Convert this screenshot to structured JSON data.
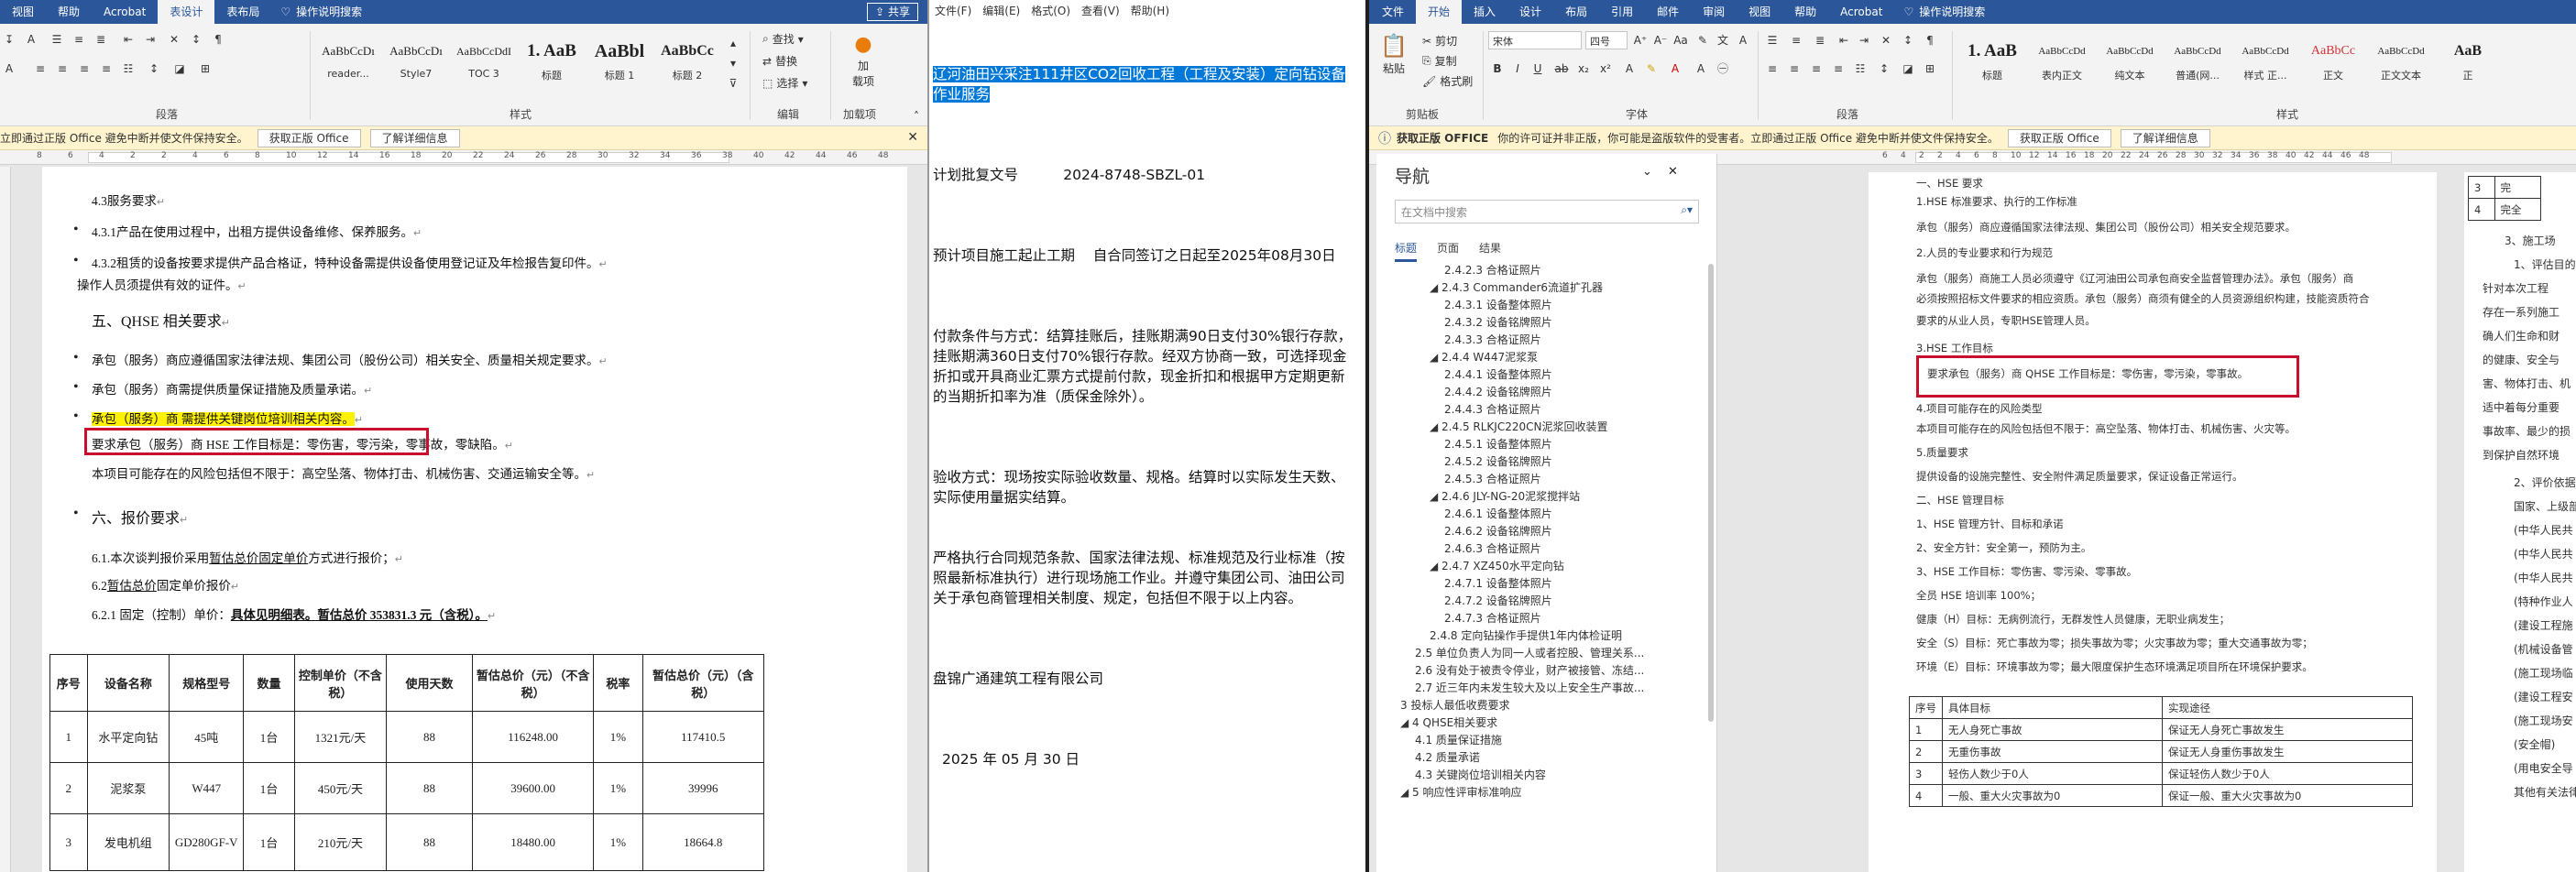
{
  "left_word": {
    "menu": [
      "视图",
      "帮助",
      "Acrobat",
      "表设计",
      "表布局"
    ],
    "menu_active": "表设计",
    "tell_me": "操作说明搜索",
    "share": "共享",
    "styles": [
      {
        "sample": "AaBbCcDı",
        "name": "reader..."
      },
      {
        "sample": "AaBbCcDı",
        "name": "Style7"
      },
      {
        "sample": "AaBbCcDdI",
        "name": "TOC 3"
      },
      {
        "sample": "1. AaB",
        "name": "标题"
      },
      {
        "sample": "AaBbl",
        "name": "标题 1"
      },
      {
        "sample": "AaBbCc",
        "name": "标题 2"
      }
    ],
    "editing": {
      "find": "查找",
      "replace": "替换",
      "select": "选择",
      "label": "编辑"
    },
    "addin": {
      "label": "加载项",
      "sub": "加\n载项"
    },
    "group_labels": {
      "paragraph": "段落",
      "styles": "样式",
      "editing": "编辑",
      "addins": "加载项"
    },
    "msgbar": {
      "text": "立即通过正版 Office 避免中断并使文件保持安全。",
      "btn1": "获取正版 Office",
      "btn2": "了解详细信息"
    },
    "ruler": [
      "8",
      "6",
      "4",
      "2",
      "2",
      "4",
      "6",
      "8",
      "10",
      "12",
      "14",
      "16",
      "18",
      "20",
      "22",
      "24",
      "26",
      "28",
      "30",
      "32",
      "34",
      "36",
      "38",
      "40",
      "42",
      "44",
      "46",
      "48"
    ],
    "doc": {
      "l1": "4.3服务要求",
      "l2": "4.3.1产品在使用过程中，出租方提供设备维修、保养服务。",
      "l3": "4.3.2租赁的设备按要求提供产品合格证，特种设备需提供设备使用登记证及年检报告复印件。",
      "l4": "操作人员须提供有效的证件。",
      "h5": "五、QHSE 相关要求",
      "l6": "承包（服务）商应遵循国家法律法规、集团公司（股份公司）相关安全、质量相关规定要求。",
      "l7": "承包（服务）商需提供质量保证措施及质量承诺。",
      "l8": "承包（服务）商 需提供关键岗位培训相关内容。",
      "l9": "要求承包（服务）商 HSE 工作目标是：零伤害，零污染，零事故，零缺陷。",
      "l10": "本项目可能存在的风险包括但不限于：高空坠落、物体打击、机械伤害、交通运输安全等。",
      "h11": "六、报价要求",
      "l12a": "6.1.本次谈判报价采用",
      "l12b": "暂估总价固定单价",
      "l12c": "方式进行报价；",
      "l13a": "6.2",
      "l13b": "暂估总价",
      "l13c": "固定单价报价",
      "l14a": "6.2.1 固定（控制）单价：",
      "l14b": "具体见明细表。暂估总价 353831.3 元（含税）。"
    },
    "table": {
      "headers": [
        "序号",
        "设备名称",
        "规格型号",
        "数量",
        "控制单价（不含税）",
        "使用天数",
        "暂估总价（元）（不含税）",
        "税率",
        "暂估总价（元）（含税）"
      ],
      "rows": [
        [
          "1",
          "水平定向钻",
          "45吨",
          "1台",
          "1321元/天",
          "88",
          "116248.00",
          "1%",
          "117410.5"
        ],
        [
          "2",
          "泥浆泵",
          "W447",
          "1台",
          "450元/天",
          "88",
          "39600.00",
          "1%",
          "39996"
        ],
        [
          "3",
          "发电机组",
          "GD280GF-V",
          "1台",
          "210元/天",
          "88",
          "18480.00",
          "1%",
          "18664.8"
        ]
      ]
    }
  },
  "notepad": {
    "menu": [
      "文件(F)",
      "编辑(E)",
      "格式(O)",
      "查看(V)",
      "帮助(H)"
    ],
    "selected": "辽河油田兴采注111井区CO2回收工程（工程及安装）定向钻设备作业服务",
    "lines": [
      "计划批复文号          2024-8748-SBZL-01",
      "预计项目施工起止工期    自合同签订之日起至2025年08月30日",
      "付款条件与方式：结算挂账后，挂账期满90日支付30%银行存款，挂账期满360日支付70%银行存款。经双方协商一致，可选择现金折扣或开具商业汇票方式提前付款，现金折扣和根据甲方定期更新的当期折扣率为准（质保金除外）。",
      "验收方式：现场按实际验收数量、规格。结算时以实际发生天数、实际使用量据实结算。",
      "严格执行合同规范条款、国家法律法规、标准规范及行业标准（按照最新标准执行）进行现场施工作业。并遵守集团公司、油田公司关于承包商管理相关制度、规定，包括但不限于以上内容。",
      "盘锦广通建筑工程有限公司",
      "2025 年 05 月 30 日"
    ]
  },
  "right_word": {
    "menu": [
      "文件",
      "开始",
      "插入",
      "设计",
      "布局",
      "引用",
      "邮件",
      "审阅",
      "视图",
      "帮助",
      "Acrobat",
      "操作说明搜索"
    ],
    "menu_active": "开始",
    "clipboard": {
      "paste": "粘贴",
      "cut": "剪切",
      "copy": "复制",
      "painter": "格式刷",
      "label": "剪贴板"
    },
    "font": {
      "name": "宋体",
      "size": "四号",
      "label": "字体"
    },
    "paragraph_label": "段落",
    "styles_label": "样式",
    "styles": [
      {
        "sample": "1. AaB",
        "name": "标题"
      },
      {
        "sample": "AaBbCcDd",
        "name": "表内正文"
      },
      {
        "sample": "AaBbCcDd",
        "name": "纯文本"
      },
      {
        "sample": "AaBbCcDd",
        "name": "普通(网..."
      },
      {
        "sample": "AaBbCcDd",
        "name": "样式 正..."
      },
      {
        "sample": "AaBbCc",
        "name": "正文"
      },
      {
        "sample": "AaBbCcDd",
        "name": "正文文本"
      },
      {
        "sample": "AaB",
        "name": "正"
      }
    ],
    "msgbar": {
      "title": "获取正版 OFFICE",
      "text": "你的许可证并非正版，你可能是盗版软件的受害者。立即通过正版 Office 避免中断并使文件保持安全。",
      "btn1": "获取正版 Office",
      "btn2": "了解详细信息"
    },
    "nav": {
      "title": "导航",
      "search_placeholder": "在文档中搜索",
      "tabs": [
        "标题",
        "页面",
        "结果"
      ],
      "items": [
        {
          "level": 4,
          "text": "2.4.2.3 合格证照片"
        },
        {
          "level": 3,
          "text": "◢ 2.4.3 Commander6流道扩孔器"
        },
        {
          "level": 4,
          "text": "2.4.3.1 设备整体照片"
        },
        {
          "level": 4,
          "text": "2.4.3.2 设备铭牌照片"
        },
        {
          "level": 4,
          "text": "2.4.3.3 合格证照片"
        },
        {
          "level": 3,
          "text": "◢ 2.4.4 W447泥浆泵"
        },
        {
          "level": 4,
          "text": "2.4.4.1 设备整体照片"
        },
        {
          "level": 4,
          "text": "2.4.4.2 设备铭牌照片"
        },
        {
          "level": 4,
          "text": "2.4.4.3 合格证照片"
        },
        {
          "level": 3,
          "text": "◢ 2.4.5 RLKJC220CN泥浆回收装置"
        },
        {
          "level": 4,
          "text": "2.4.5.1 设备整体照片"
        },
        {
          "level": 4,
          "text": "2.4.5.2 设备铭牌照片"
        },
        {
          "level": 4,
          "text": "2.4.5.3 合格证照片"
        },
        {
          "level": 3,
          "text": "◢ 2.4.6 JLY-NG-20泥浆搅拌站"
        },
        {
          "level": 4,
          "text": "2.4.6.1 设备整体照片"
        },
        {
          "level": 4,
          "text": "2.4.6.2 设备铭牌照片"
        },
        {
          "level": 4,
          "text": "2.4.6.3 合格证照片"
        },
        {
          "level": 3,
          "text": "◢ 2.4.7 XZ450水平定向钻"
        },
        {
          "level": 4,
          "text": "2.4.7.1 设备整体照片"
        },
        {
          "level": 4,
          "text": "2.4.7.2 设备铭牌照片"
        },
        {
          "level": 4,
          "text": "2.4.7.3 合格证照片"
        },
        {
          "level": 3,
          "text": "2.4.8 定向钻操作手提供1年内体检证明"
        },
        {
          "level": 2,
          "text": "2.5 单位负责人为同一人或者控股、管理关系..."
        },
        {
          "level": 2,
          "text": "2.6 没有处于被责令停业，财产被接管、冻结..."
        },
        {
          "level": 2,
          "text": "2.7 近三年内未发生较大及以上安全生产事故..."
        },
        {
          "level": 1,
          "text": "3 投标人最低收费要求"
        },
        {
          "level": 1,
          "text": "◢ 4 QHSE相关要求"
        },
        {
          "level": 2,
          "text": "4.1 质量保证措施"
        },
        {
          "level": 2,
          "text": "4.2 质量承诺"
        },
        {
          "level": 2,
          "text": "4.3 关键岗位培训相关内容"
        },
        {
          "level": 1,
          "text": "◢ 5 响应性评审标准响应"
        }
      ]
    },
    "ruler": [
      "6",
      "4",
      "2",
      "2",
      "4",
      "6",
      "8",
      "10",
      "12",
      "14",
      "16",
      "18",
      "20",
      "22",
      "24",
      "26",
      "28",
      "30",
      "32",
      "34",
      "36",
      "38",
      "40",
      "42",
      "44",
      "46",
      "48"
    ],
    "doc": {
      "l0": "一、HSE 要求",
      "l1": "1.HSE 标准要求、执行的工作标准",
      "l2": "承包（服务）商应遵循国家法律法规、集团公司（股份公司）相关安全规范要求。",
      "l3": "2.人员的专业要求和行为规范",
      "l4": "承包（服务）商施工人员必须遵守《辽河油田公司承包商安全监督管理办法》。承包（服务）商",
      "l5": "必须按照招标文件要求的相应资质。承包（服务）商须有健全的人员资源组织构建，技能资质符合",
      "l6": "要求的从业人员，专职HSE管理人员。",
      "l7": "3.HSE 工作目标",
      "l8": "要求承包（服务）商 QHSE 工作目标是：零伤害，零污染，零事故。",
      "l9": "4.项目可能存在的风险类型",
      "l10": "本项目可能存在的风险包括但不限于：高空坠落、物体打击、机械伤害、火灾等。",
      "l11": "5.质量要求",
      "l12": "提供设备的设施完整性、安全附件满足质量要求，保证设备正常运行。",
      "l13": "二、HSE 管理目标",
      "l14": "1、HSE 管理方针、目标和承诺",
      "l15": "2、安全方针：安全第一，预防为主。",
      "l16": "3、HSE 工作目标：零伤害、零污染、零事故。",
      "l17": "全员 HSE 培训率 100%；",
      "l18": "健康（H）目标：无病例流行，无群发性人员健康，无职业病发生；",
      "l19": "安全（S）目标：死亡事故为零；损失事故为零；火灾事故为零；重大交通事故为零；",
      "l20": "环境（E）目标：环境事故为零；最大限度保护生态环境满足项目所在环境保护要求。"
    },
    "table": {
      "headers": [
        "序号",
        "具体目标",
        "实现途径"
      ],
      "rows": [
        [
          "1",
          "无人身死亡事故",
          "保证无人身死亡事故发生"
        ],
        [
          "2",
          "无重伤事故",
          "保证无人身重伤事故发生"
        ],
        [
          "3",
          "轻伤人数少于0人",
          "保证轻伤人数少于0人"
        ],
        [
          "4",
          "一般、重大火灾事故为0",
          "保证一般、重大火灾事故为0"
        ]
      ]
    },
    "side": {
      "l1": "3、施工场",
      "l2": "1、评估目的：",
      "l3": "针对本次工程",
      "l4": "存在一系列施工",
      "l5": "确人们生命和财",
      "l6": "的健康、安全与",
      "l7": "害、物体打击、机",
      "l8": "适中着每分重要",
      "l9": "事故率、最少的损",
      "l10": "到保护自然环境",
      "l11": "2、评价依据：",
      "l12": "国家、上级部",
      "l13": "(中华人民共",
      "l14": "(中华人民共",
      "l15": "(中华人民共",
      "l16": "(特种作业人",
      "l17": "(建设工程施",
      "l18": "(机械设备管",
      "l19": "(施工现场临",
      "l20": "(建设工程安",
      "l21": "(施工现场安",
      "l22": "(安全帽)",
      "l23": "(用电安全导",
      "l24": "其他有关法律"
    },
    "side_table": {
      "r1": "3",
      "r2": "4",
      "c1": "完",
      "c2": "完全"
    }
  }
}
